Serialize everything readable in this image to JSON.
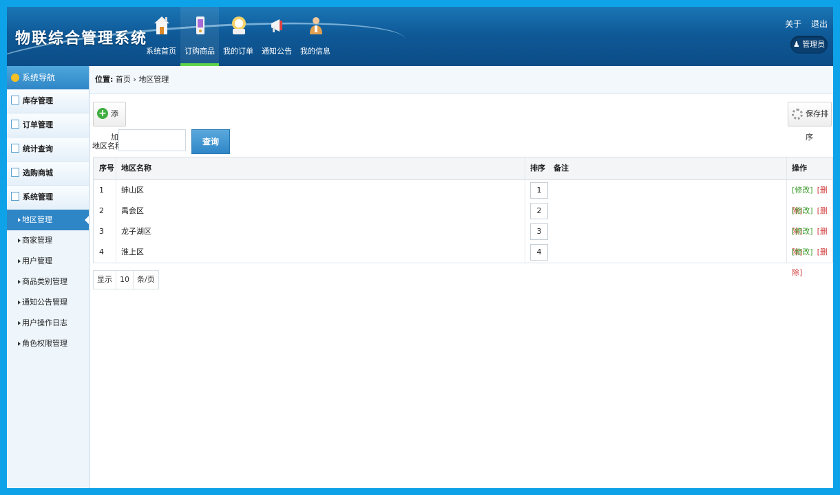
{
  "app": {
    "title": "物联综合管理系统"
  },
  "nav": [
    {
      "label": "系统首页",
      "icon": "home-icon"
    },
    {
      "label": "订购商品",
      "icon": "phone-icon",
      "active": true
    },
    {
      "label": "我的订单",
      "icon": "order-icon"
    },
    {
      "label": "通知公告",
      "icon": "megaphone-icon"
    },
    {
      "label": "我的信息",
      "icon": "user-icon"
    }
  ],
  "top_links": {
    "about": "关于",
    "logout": "退出"
  },
  "admin": {
    "label": "管理员"
  },
  "sidebar": {
    "header": "系统导航",
    "menus": [
      "库存管理",
      "订单管理",
      "统计查询",
      "选购商城",
      "系统管理"
    ],
    "sub_items": [
      "地区管理",
      "商家管理",
      "用户管理",
      "商品类别管理",
      "通知公告管理",
      "用户操作日志",
      "角色权限管理"
    ],
    "active_sub": "地区管理"
  },
  "breadcrumb": {
    "prefix": "位置:",
    "home": "首页",
    "sep": "›",
    "current": "地区管理"
  },
  "toolbar": {
    "add_label": "添加",
    "save_sort_label": "保存排序"
  },
  "search": {
    "label": "地区名称",
    "value": "",
    "button_label": "查询"
  },
  "table": {
    "headers": {
      "no": "序号",
      "name": "地区名称",
      "sort": "排序",
      "note": "备注",
      "op": "操作"
    },
    "rows": [
      {
        "no": "1",
        "name": "蚌山区",
        "sort": "1",
        "note": ""
      },
      {
        "no": "2",
        "name": "禹会区",
        "sort": "2",
        "note": ""
      },
      {
        "no": "3",
        "name": "龙子湖区",
        "sort": "3",
        "note": ""
      },
      {
        "no": "4",
        "name": "淮上区",
        "sort": "4",
        "note": ""
      }
    ],
    "edit_label": "[修改]",
    "delete_label": "[删除]"
  },
  "pager": {
    "show": "显示",
    "size": "10",
    "unit": "条/页"
  },
  "colors": {
    "accent": "#2f86c6",
    "header": "#0f5a98",
    "edit": "#3a9a2a",
    "delete": "#d23b3b"
  }
}
